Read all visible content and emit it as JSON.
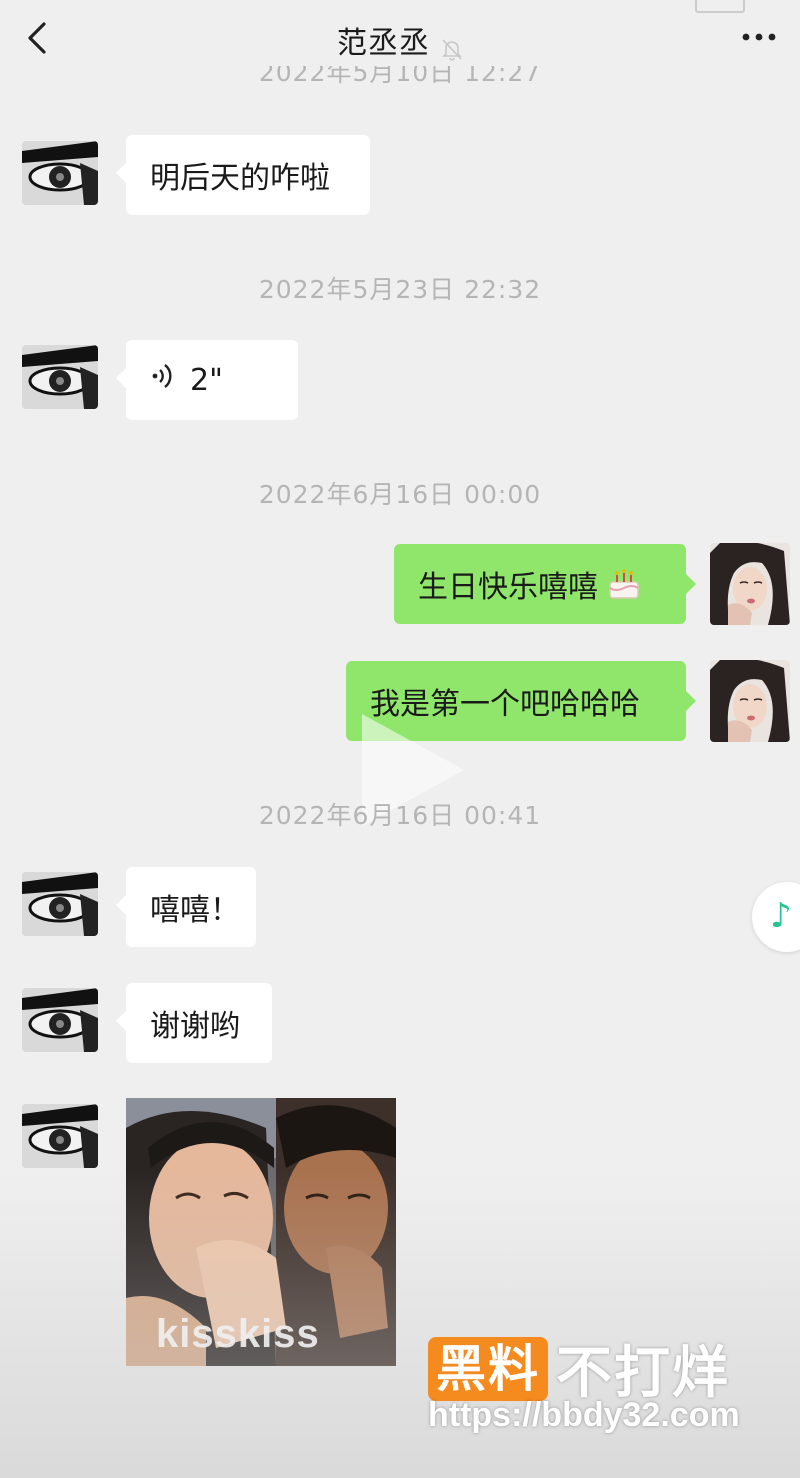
{
  "header": {
    "title": "范丞丞",
    "back_icon": "chevron-left-icon",
    "mute_icon": "bell-off-icon",
    "more_icon": "more-dots-icon"
  },
  "timestamps": {
    "ts0": "2022年5月10日 12:27",
    "ts1": "2022年5月23日 22:32",
    "ts2": "2022年6月16日 00:00",
    "ts3": "2022年6月16日 00:41"
  },
  "messages": {
    "m1": "明后天的咋啦",
    "m2_voice": "2\"",
    "m3": "生日快乐嘻嘻",
    "m4": "我是第一个吧哈哈哈",
    "m5": "嘻嘻！",
    "m6": "谢谢哟"
  },
  "sticker": {
    "caption": "kisskiss"
  },
  "watermark": {
    "badge": "黑料",
    "text": "不打烊",
    "url": "https://bbdy32.com"
  },
  "colors": {
    "outgoing_bubble": "#8fe66a",
    "incoming_bubble": "#ffffff",
    "watermark_orange": "#f58a1f",
    "music_green": "#25c48a"
  }
}
